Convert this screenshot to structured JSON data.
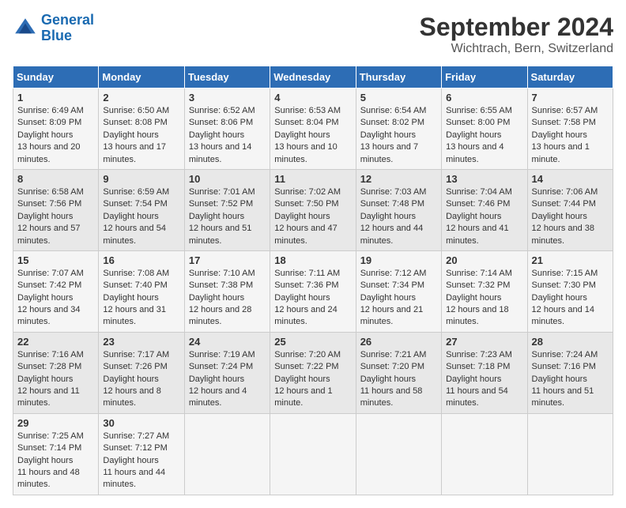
{
  "header": {
    "logo_line1": "General",
    "logo_line2": "Blue",
    "title": "September 2024",
    "subtitle": "Wichtrach, Bern, Switzerland"
  },
  "columns": [
    "Sunday",
    "Monday",
    "Tuesday",
    "Wednesday",
    "Thursday",
    "Friday",
    "Saturday"
  ],
  "weeks": [
    [
      {
        "day": "1",
        "rise": "6:49 AM",
        "set": "8:09 PM",
        "daylight": "13 hours and 20 minutes."
      },
      {
        "day": "2",
        "rise": "6:50 AM",
        "set": "8:08 PM",
        "daylight": "13 hours and 17 minutes."
      },
      {
        "day": "3",
        "rise": "6:52 AM",
        "set": "8:06 PM",
        "daylight": "13 hours and 14 minutes."
      },
      {
        "day": "4",
        "rise": "6:53 AM",
        "set": "8:04 PM",
        "daylight": "13 hours and 10 minutes."
      },
      {
        "day": "5",
        "rise": "6:54 AM",
        "set": "8:02 PM",
        "daylight": "13 hours and 7 minutes."
      },
      {
        "day": "6",
        "rise": "6:55 AM",
        "set": "8:00 PM",
        "daylight": "13 hours and 4 minutes."
      },
      {
        "day": "7",
        "rise": "6:57 AM",
        "set": "7:58 PM",
        "daylight": "13 hours and 1 minute."
      }
    ],
    [
      {
        "day": "8",
        "rise": "6:58 AM",
        "set": "7:56 PM",
        "daylight": "12 hours and 57 minutes."
      },
      {
        "day": "9",
        "rise": "6:59 AM",
        "set": "7:54 PM",
        "daylight": "12 hours and 54 minutes."
      },
      {
        "day": "10",
        "rise": "7:01 AM",
        "set": "7:52 PM",
        "daylight": "12 hours and 51 minutes."
      },
      {
        "day": "11",
        "rise": "7:02 AM",
        "set": "7:50 PM",
        "daylight": "12 hours and 47 minutes."
      },
      {
        "day": "12",
        "rise": "7:03 AM",
        "set": "7:48 PM",
        "daylight": "12 hours and 44 minutes."
      },
      {
        "day": "13",
        "rise": "7:04 AM",
        "set": "7:46 PM",
        "daylight": "12 hours and 41 minutes."
      },
      {
        "day": "14",
        "rise": "7:06 AM",
        "set": "7:44 PM",
        "daylight": "12 hours and 38 minutes."
      }
    ],
    [
      {
        "day": "15",
        "rise": "7:07 AM",
        "set": "7:42 PM",
        "daylight": "12 hours and 34 minutes."
      },
      {
        "day": "16",
        "rise": "7:08 AM",
        "set": "7:40 PM",
        "daylight": "12 hours and 31 minutes."
      },
      {
        "day": "17",
        "rise": "7:10 AM",
        "set": "7:38 PM",
        "daylight": "12 hours and 28 minutes."
      },
      {
        "day": "18",
        "rise": "7:11 AM",
        "set": "7:36 PM",
        "daylight": "12 hours and 24 minutes."
      },
      {
        "day": "19",
        "rise": "7:12 AM",
        "set": "7:34 PM",
        "daylight": "12 hours and 21 minutes."
      },
      {
        "day": "20",
        "rise": "7:14 AM",
        "set": "7:32 PM",
        "daylight": "12 hours and 18 minutes."
      },
      {
        "day": "21",
        "rise": "7:15 AM",
        "set": "7:30 PM",
        "daylight": "12 hours and 14 minutes."
      }
    ],
    [
      {
        "day": "22",
        "rise": "7:16 AM",
        "set": "7:28 PM",
        "daylight": "12 hours and 11 minutes."
      },
      {
        "day": "23",
        "rise": "7:17 AM",
        "set": "7:26 PM",
        "daylight": "12 hours and 8 minutes."
      },
      {
        "day": "24",
        "rise": "7:19 AM",
        "set": "7:24 PM",
        "daylight": "12 hours and 4 minutes."
      },
      {
        "day": "25",
        "rise": "7:20 AM",
        "set": "7:22 PM",
        "daylight": "12 hours and 1 minute."
      },
      {
        "day": "26",
        "rise": "7:21 AM",
        "set": "7:20 PM",
        "daylight": "11 hours and 58 minutes."
      },
      {
        "day": "27",
        "rise": "7:23 AM",
        "set": "7:18 PM",
        "daylight": "11 hours and 54 minutes."
      },
      {
        "day": "28",
        "rise": "7:24 AM",
        "set": "7:16 PM",
        "daylight": "11 hours and 51 minutes."
      }
    ],
    [
      {
        "day": "29",
        "rise": "7:25 AM",
        "set": "7:14 PM",
        "daylight": "11 hours and 48 minutes."
      },
      {
        "day": "30",
        "rise": "7:27 AM",
        "set": "7:12 PM",
        "daylight": "11 hours and 44 minutes."
      },
      null,
      null,
      null,
      null,
      null
    ]
  ]
}
